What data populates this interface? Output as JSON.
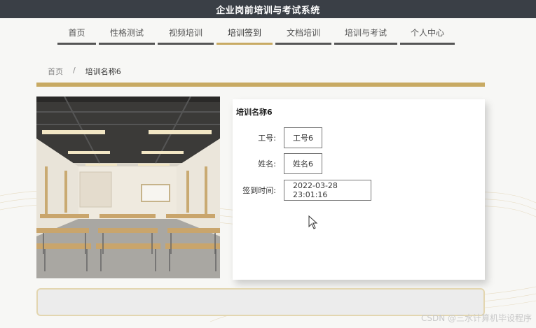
{
  "app": {
    "title": "企业岗前培训与考试系统"
  },
  "nav": {
    "tabs": [
      {
        "label": "首页",
        "active": false
      },
      {
        "label": "性格测试",
        "active": false
      },
      {
        "label": "视频培训",
        "active": false
      },
      {
        "label": "培训签到",
        "active": true
      },
      {
        "label": "文档培训",
        "active": false
      },
      {
        "label": "培训与考试",
        "active": false
      },
      {
        "label": "个人中心",
        "active": false
      }
    ]
  },
  "breadcrumb": {
    "home": "首页",
    "separator": "/",
    "current": "培训名称6"
  },
  "detail": {
    "title": "培训名称6",
    "fields": [
      {
        "label": "工号:",
        "value": "工号6"
      },
      {
        "label": "姓名:",
        "value": "姓名6"
      },
      {
        "label": "签到时间:",
        "value": "2022-03-28 23:01:16"
      }
    ]
  },
  "watermark": "CSDN @三水计算机毕设程序",
  "colors": {
    "accent": "#c8aa63",
    "topbar": "#3a3f46"
  }
}
